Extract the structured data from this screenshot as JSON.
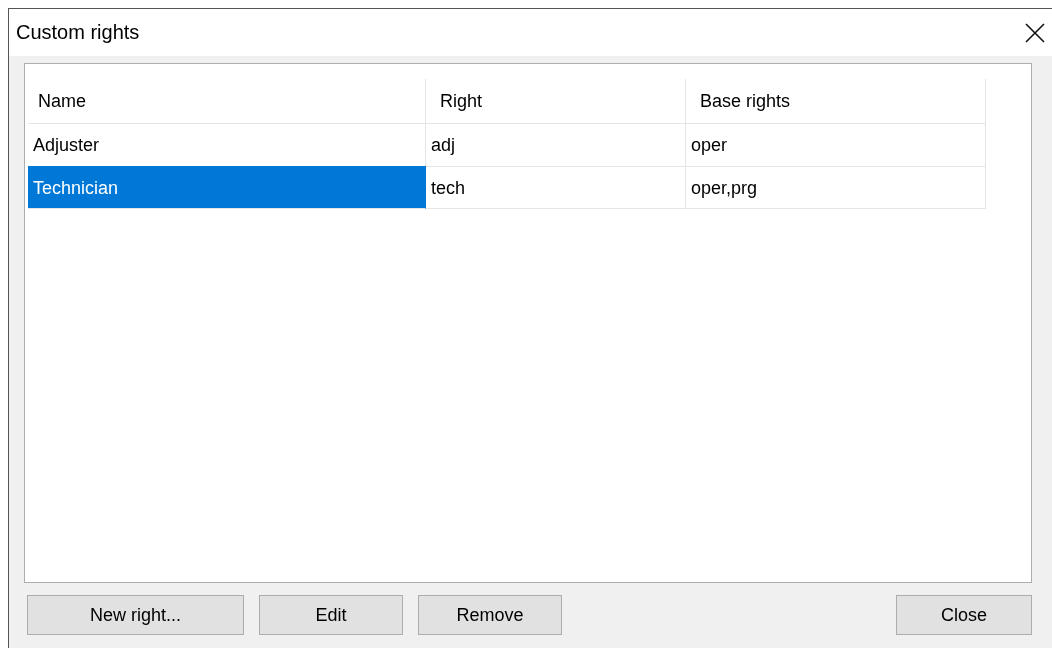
{
  "window": {
    "title": "Custom rights"
  },
  "table": {
    "columns": [
      "Name",
      "Right",
      "Base rights"
    ],
    "rows": [
      {
        "cells": [
          "Adjuster",
          "adj",
          "oper"
        ],
        "selected": false
      },
      {
        "cells": [
          "Technician",
          "tech",
          "oper,prg"
        ],
        "selected": true
      }
    ]
  },
  "buttons": [
    {
      "label": "New right...",
      "kind": "action"
    },
    {
      "label": "Edit",
      "kind": "action"
    },
    {
      "label": "Remove",
      "kind": "action"
    },
    {
      "label": "Close",
      "kind": "dismiss"
    }
  ]
}
